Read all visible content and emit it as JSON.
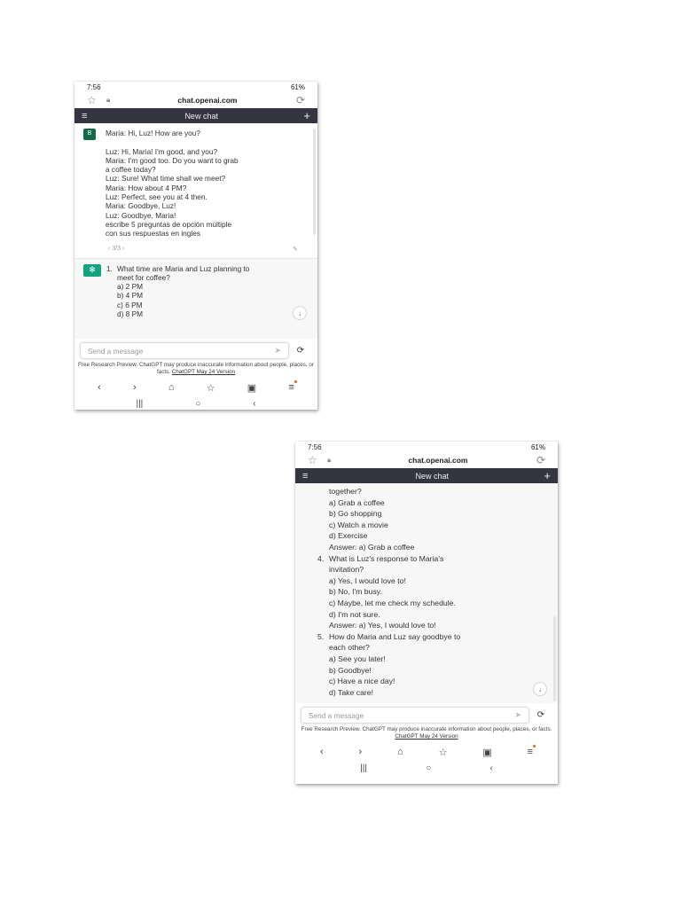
{
  "status_bar": {
    "time": "7:56",
    "right": "61%"
  },
  "browser": {
    "url": "chat.openai.com"
  },
  "chat": {
    "title": "New chat"
  },
  "user_message": {
    "avatar": "B",
    "lines": [
      "Maria: Hi, Luz! How are you?",
      "",
      "Luz: Hi, Maria! I'm good, and you?",
      "Maria: I'm good too. Do you want to grab",
      "a coffee today?",
      "Luz: Sure! What time shall we meet?",
      "Maria: How about 4 PM?",
      "Luz: Perfect, see you at 4 then.",
      "Maria: Goodbye, Luz!",
      "Luz: Goodbye, Maria!",
      "escribe 5 preguntas de opción múltiple",
      "con sus respuestas en ingles"
    ],
    "pager": "‹ 3/3 ›"
  },
  "assistant_top": {
    "question_number": "1.",
    "question_lines": [
      "What time are Maria and Luz planning to",
      "meet for coffee?"
    ],
    "options": [
      "a) 2 PM",
      "b) 4 PM",
      "c) 6 PM",
      "d) 8 PM"
    ]
  },
  "assistant_bottom": {
    "lines": [
      {
        "kind": "sub",
        "text": "together?"
      },
      {
        "kind": "sub",
        "text": "a) Grab a coffee"
      },
      {
        "kind": "sub",
        "text": "b) Go shopping"
      },
      {
        "kind": "sub",
        "text": "c) Watch a movie"
      },
      {
        "kind": "sub",
        "text": "d) Exercise"
      },
      {
        "kind": "sub",
        "text": "Answer: a) Grab a coffee"
      },
      {
        "kind": "q",
        "num": "4.",
        "text": "What is Luz's response to Maria's"
      },
      {
        "kind": "sub",
        "text": "invitation?"
      },
      {
        "kind": "sub",
        "text": "a) Yes, I would love to!"
      },
      {
        "kind": "sub",
        "text": "b) No, I'm busy."
      },
      {
        "kind": "sub",
        "text": "c) Maybe, let me check my schedule."
      },
      {
        "kind": "sub",
        "text": "d) I'm not sure."
      },
      {
        "kind": "sub",
        "text": "Answer: a) Yes, I would love to!"
      },
      {
        "kind": "q",
        "num": "5.",
        "text": "How do Maria and Luz say goodbye to"
      },
      {
        "kind": "sub",
        "text": "each other?"
      },
      {
        "kind": "sub",
        "text": "a) See you later!"
      },
      {
        "kind": "sub",
        "text": "b) Goodbye!"
      },
      {
        "kind": "sub",
        "text": "c) Have a nice day!"
      },
      {
        "kind": "sub",
        "text": "d) Take care!"
      }
    ]
  },
  "composer": {
    "placeholder": "Send a message"
  },
  "disclaimer": {
    "text": "Free Research Preview. ChatGPT may produce inaccurate information about people, places, or facts.",
    "link": "ChatGPT May 24 Version"
  },
  "icons": {
    "back": "‹",
    "forward": "›",
    "home": "⌂",
    "bookmark": "☆",
    "tabs": "▣",
    "menu": "≡",
    "recent": "|||",
    "home_sys": "○",
    "back_sys": "‹",
    "regenerate": "⟳",
    "send": "➤",
    "scroll_down": "↓"
  },
  "colors": {
    "header": "#343541",
    "gpt_green": "#10a37f",
    "user_avatar": "#126a47",
    "assistant_bg": "#f7f7f8"
  }
}
